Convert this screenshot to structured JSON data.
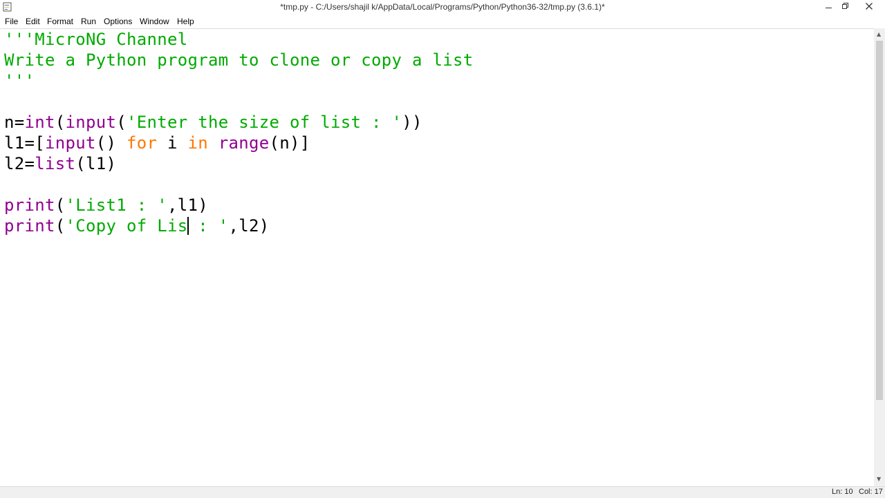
{
  "window": {
    "title": "*tmp.py - C:/Users/shajil k/AppData/Local/Programs/Python/Python36-32/tmp.py (3.6.1)*",
    "minimize_icon": "minimize-icon",
    "restore_icon": "restore-icon",
    "close_icon": "close-icon",
    "app_icon": "python-idle-icon"
  },
  "menu": {
    "items": [
      {
        "label": "File"
      },
      {
        "label": "Edit"
      },
      {
        "label": "Format"
      },
      {
        "label": "Run"
      },
      {
        "label": "Options"
      },
      {
        "label": "Window"
      },
      {
        "label": "Help"
      }
    ]
  },
  "editor": {
    "lines": [
      [
        {
          "t": "str",
          "v": "'''MicroNG Channel"
        }
      ],
      [
        {
          "t": "str",
          "v": "Write a Python program to clone or copy a list"
        }
      ],
      [
        {
          "t": "str",
          "v": "'''"
        }
      ],
      [
        {
          "t": "plain",
          "v": ""
        }
      ],
      [
        {
          "t": "plain",
          "v": "n="
        },
        {
          "t": "bi",
          "v": "int"
        },
        {
          "t": "plain",
          "v": "("
        },
        {
          "t": "bi",
          "v": "input"
        },
        {
          "t": "plain",
          "v": "("
        },
        {
          "t": "str",
          "v": "'Enter the size of list : '"
        },
        {
          "t": "plain",
          "v": "))"
        }
      ],
      [
        {
          "t": "plain",
          "v": "l1=["
        },
        {
          "t": "bi",
          "v": "input"
        },
        {
          "t": "plain",
          "v": "() "
        },
        {
          "t": "kw",
          "v": "for"
        },
        {
          "t": "plain",
          "v": " i "
        },
        {
          "t": "kw",
          "v": "in"
        },
        {
          "t": "plain",
          "v": " "
        },
        {
          "t": "bi",
          "v": "range"
        },
        {
          "t": "plain",
          "v": "(n)]"
        }
      ],
      [
        {
          "t": "plain",
          "v": "l2="
        },
        {
          "t": "bi",
          "v": "list"
        },
        {
          "t": "plain",
          "v": "(l1)"
        }
      ],
      [
        {
          "t": "plain",
          "v": ""
        }
      ],
      [
        {
          "t": "bi",
          "v": "print"
        },
        {
          "t": "plain",
          "v": "("
        },
        {
          "t": "str",
          "v": "'List1 : '"
        },
        {
          "t": "plain",
          "v": ",l1)"
        }
      ],
      [
        {
          "t": "bi",
          "v": "print"
        },
        {
          "t": "plain",
          "v": "("
        },
        {
          "t": "str",
          "v": "'Copy of Lis"
        },
        {
          "t": "cursor",
          "v": ""
        },
        {
          "t": "str",
          "v": " : '"
        },
        {
          "t": "plain",
          "v": ",l2)"
        }
      ]
    ]
  },
  "status": {
    "ln": "Ln: 10",
    "col": "Col: 17"
  },
  "colors": {
    "string": "#00aa00",
    "keyword": "#ff7700",
    "builtin": "#900090",
    "text": "#000000"
  }
}
